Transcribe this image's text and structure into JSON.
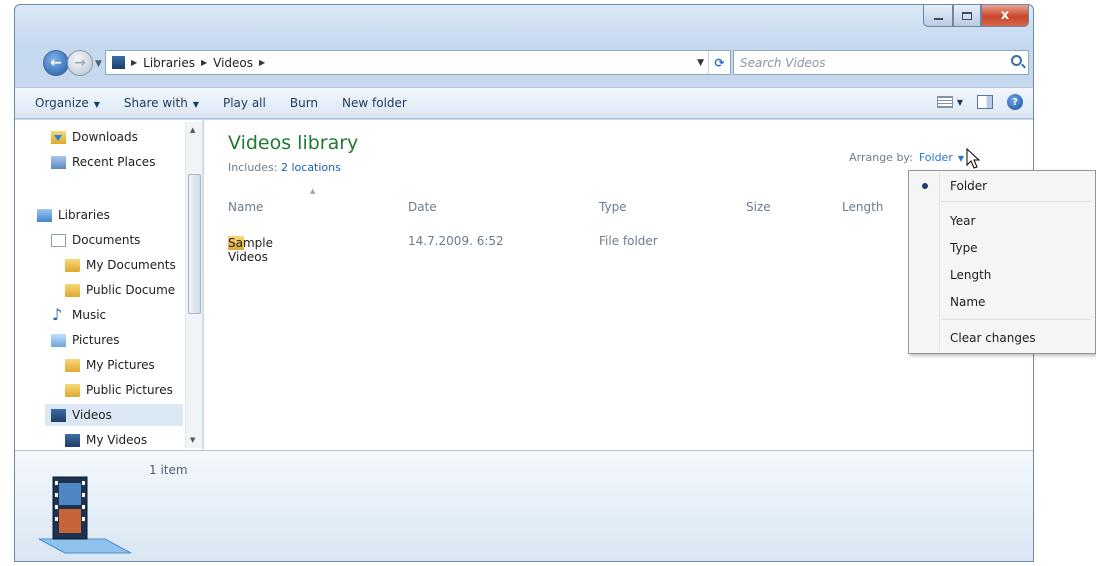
{
  "window": {
    "close_glyph": "x"
  },
  "nav": {
    "back_glyph": "←",
    "forward_glyph": "→"
  },
  "address": {
    "crumbs": [
      "Libraries",
      "Videos"
    ],
    "refresh_glyph": "⟳"
  },
  "search": {
    "placeholder": "Search Videos"
  },
  "toolbar": {
    "organize": "Organize",
    "share_with": "Share with",
    "play_all": "Play all",
    "burn": "Burn",
    "new_folder": "New folder",
    "help_glyph": "?"
  },
  "navpane": {
    "items": [
      {
        "label": "Downloads",
        "icon": "downloads-icon"
      },
      {
        "label": "Recent Places",
        "icon": "recent-places-icon"
      },
      {
        "label": "Libraries",
        "icon": "libraries-icon"
      },
      {
        "label": "Documents",
        "icon": "documents-icon"
      },
      {
        "label": "My Documents",
        "icon": "folder-icon"
      },
      {
        "label": "Public Docume",
        "icon": "folder-icon"
      },
      {
        "label": "Music",
        "icon": "music-icon"
      },
      {
        "label": "Pictures",
        "icon": "pictures-icon"
      },
      {
        "label": "My Pictures",
        "icon": "folder-icon"
      },
      {
        "label": "Public Pictures",
        "icon": "folder-icon"
      },
      {
        "label": "Videos",
        "icon": "videos-icon"
      },
      {
        "label": "My Videos",
        "icon": "videos-folder-icon"
      }
    ]
  },
  "library": {
    "title": "Videos library",
    "includes_label": "Includes:",
    "includes_link": "2 locations",
    "arrange_label": "Arrange by:",
    "arrange_value": "Folder"
  },
  "columns": {
    "name": "Name",
    "date": "Date",
    "type": "Type",
    "size": "Size",
    "length": "Length"
  },
  "files": [
    {
      "name": "Sample Videos",
      "date": "14.7.2009. 6:52",
      "type": "File folder"
    }
  ],
  "details": {
    "count": "1 item"
  },
  "arrange_menu": {
    "items": [
      "Folder",
      "Year",
      "Type",
      "Length",
      "Name",
      "Clear changes"
    ],
    "selected": "Folder"
  }
}
